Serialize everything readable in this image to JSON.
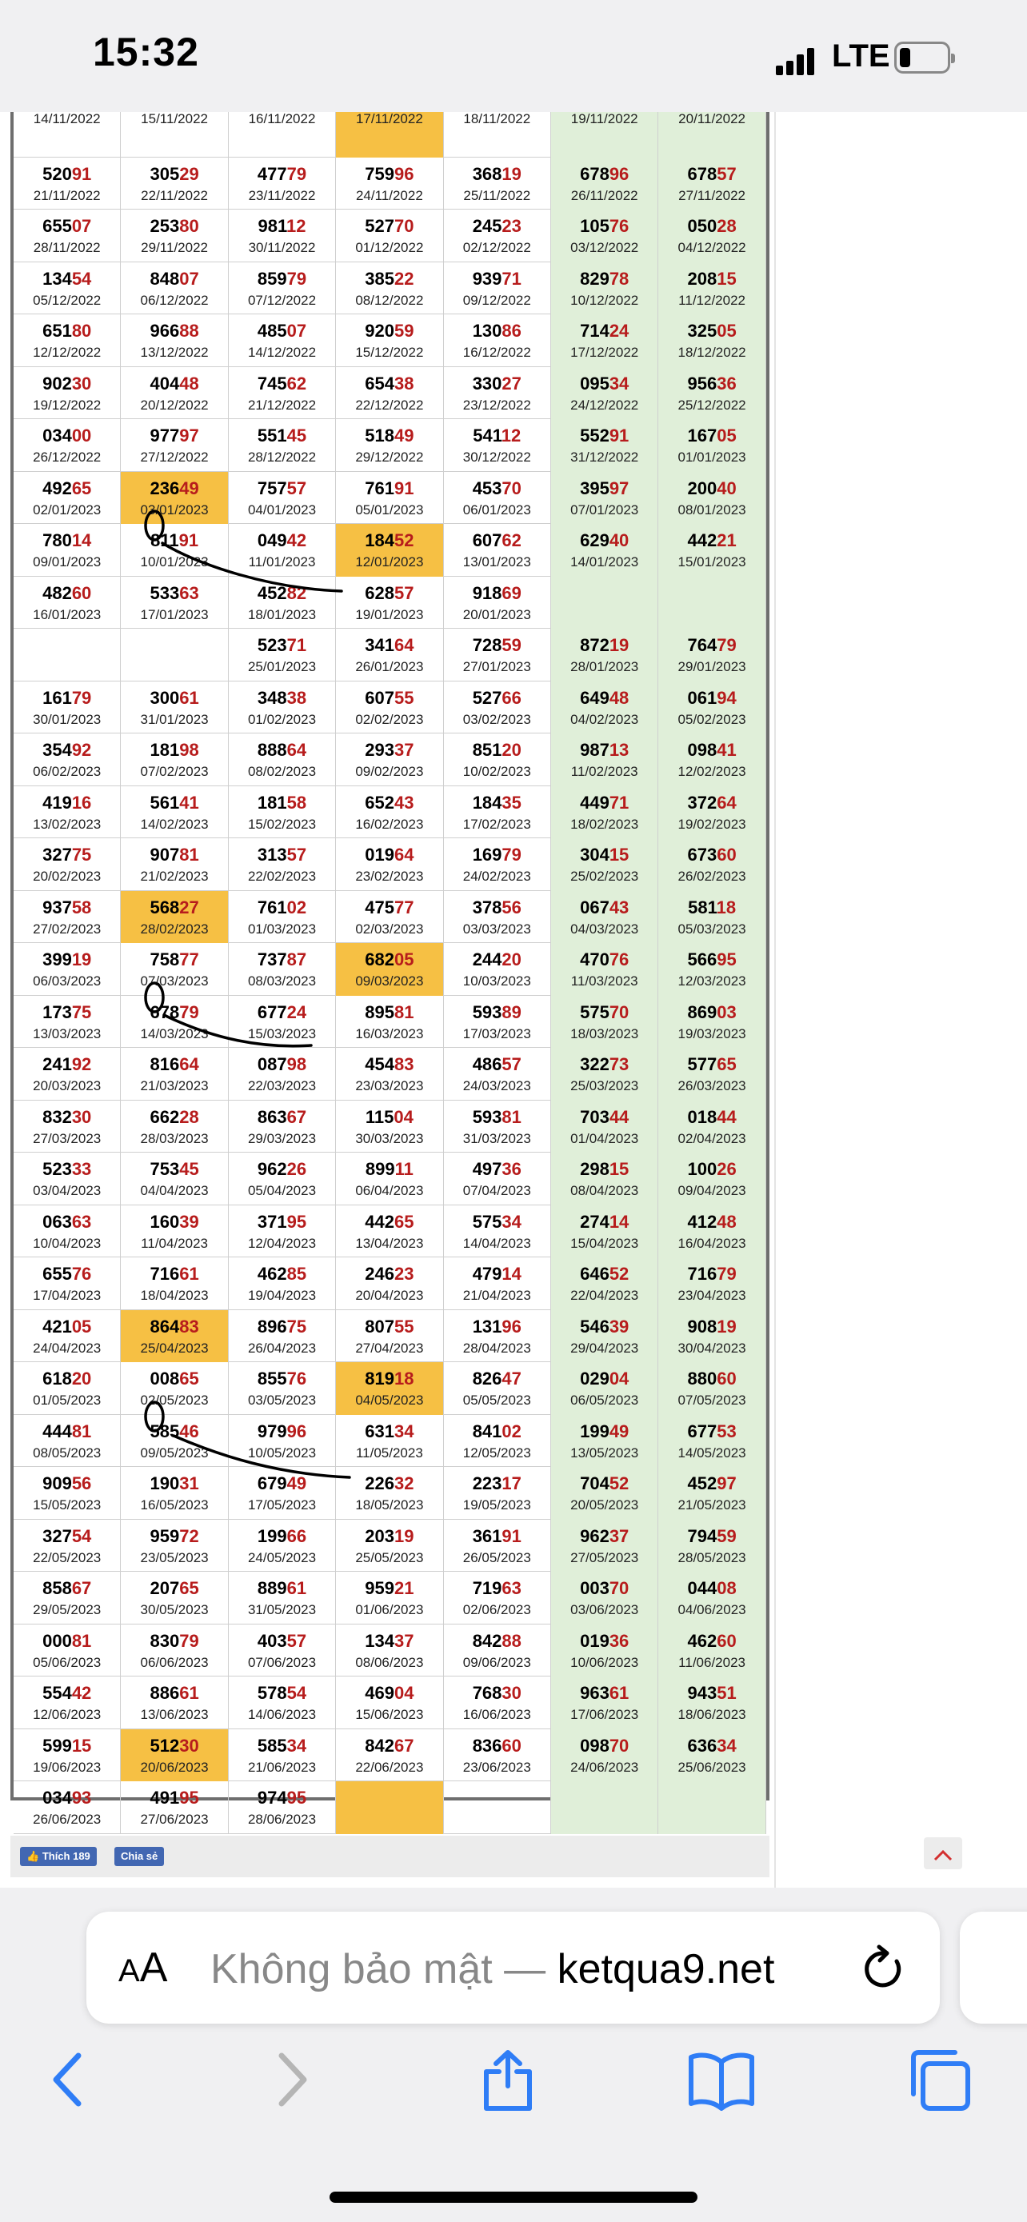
{
  "status_bar": {
    "time": "15:32",
    "network": "LTE"
  },
  "table": {
    "rows": [
      [
        [
          "",
          "14/11/2022"
        ],
        [
          "",
          "15/11/2022"
        ],
        [
          "",
          "16/11/2022"
        ],
        [
          "",
          "17/11/2022",
          "hl"
        ],
        [
          "",
          "18/11/2022"
        ],
        [
          "",
          "19/11/2022"
        ],
        [
          "",
          "20/11/2022"
        ]
      ],
      [
        [
          "52091",
          "21/11/2022"
        ],
        [
          "30529",
          "22/11/2022"
        ],
        [
          "47779",
          "23/11/2022"
        ],
        [
          "75996",
          "24/11/2022"
        ],
        [
          "36819",
          "25/11/2022"
        ],
        [
          "67896",
          "26/11/2022"
        ],
        [
          "67857",
          "27/11/2022"
        ]
      ],
      [
        [
          "65507",
          "28/11/2022"
        ],
        [
          "25380",
          "29/11/2022"
        ],
        [
          "98112",
          "30/11/2022"
        ],
        [
          "52770",
          "01/12/2022"
        ],
        [
          "24523",
          "02/12/2022"
        ],
        [
          "10576",
          "03/12/2022"
        ],
        [
          "05028",
          "04/12/2022"
        ]
      ],
      [
        [
          "13454",
          "05/12/2022"
        ],
        [
          "84807",
          "06/12/2022"
        ],
        [
          "85979",
          "07/12/2022"
        ],
        [
          "38522",
          "08/12/2022"
        ],
        [
          "93971",
          "09/12/2022"
        ],
        [
          "82978",
          "10/12/2022"
        ],
        [
          "20815",
          "11/12/2022"
        ]
      ],
      [
        [
          "65180",
          "12/12/2022"
        ],
        [
          "96688",
          "13/12/2022"
        ],
        [
          "48507",
          "14/12/2022"
        ],
        [
          "92059",
          "15/12/2022"
        ],
        [
          "13086",
          "16/12/2022"
        ],
        [
          "71424",
          "17/12/2022"
        ],
        [
          "32505",
          "18/12/2022"
        ]
      ],
      [
        [
          "90230",
          "19/12/2022"
        ],
        [
          "40448",
          "20/12/2022"
        ],
        [
          "74562",
          "21/12/2022"
        ],
        [
          "65438",
          "22/12/2022"
        ],
        [
          "33027",
          "23/12/2022"
        ],
        [
          "09534",
          "24/12/2022"
        ],
        [
          "95636",
          "25/12/2022"
        ]
      ],
      [
        [
          "03400",
          "26/12/2022"
        ],
        [
          "97797",
          "27/12/2022"
        ],
        [
          "55145",
          "28/12/2022"
        ],
        [
          "51849",
          "29/12/2022"
        ],
        [
          "54112",
          "30/12/2022"
        ],
        [
          "55291",
          "31/12/2022"
        ],
        [
          "16705",
          "01/01/2023"
        ]
      ],
      [
        [
          "49265",
          "02/01/2023"
        ],
        [
          "23649",
          "03/01/2023",
          "hl"
        ],
        [
          "75757",
          "04/01/2023"
        ],
        [
          "76191",
          "05/01/2023"
        ],
        [
          "45370",
          "06/01/2023"
        ],
        [
          "39597",
          "07/01/2023"
        ],
        [
          "20040",
          "08/01/2023"
        ]
      ],
      [
        [
          "78014",
          "09/01/2023"
        ],
        [
          "81191",
          "10/01/2023"
        ],
        [
          "04942",
          "11/01/2023"
        ],
        [
          "18452",
          "12/01/2023",
          "hl"
        ],
        [
          "60762",
          "13/01/2023"
        ],
        [
          "62940",
          "14/01/2023"
        ],
        [
          "44221",
          "15/01/2023"
        ]
      ],
      [
        [
          "48260",
          "16/01/2023"
        ],
        [
          "53363",
          "17/01/2023"
        ],
        [
          "45282",
          "18/01/2023"
        ],
        [
          "62857",
          "19/01/2023"
        ],
        [
          "91869",
          "20/01/2023"
        ],
        [
          "",
          ""
        ],
        [
          "",
          ""
        ]
      ],
      [
        [
          "",
          ""
        ],
        [
          "",
          ""
        ],
        [
          "52371",
          "25/01/2023"
        ],
        [
          "34164",
          "26/01/2023"
        ],
        [
          "72859",
          "27/01/2023"
        ],
        [
          "87219",
          "28/01/2023"
        ],
        [
          "76479",
          "29/01/2023"
        ]
      ],
      [
        [
          "16179",
          "30/01/2023"
        ],
        [
          "30061",
          "31/01/2023"
        ],
        [
          "34838",
          "01/02/2023"
        ],
        [
          "60755",
          "02/02/2023"
        ],
        [
          "52766",
          "03/02/2023"
        ],
        [
          "64948",
          "04/02/2023"
        ],
        [
          "06194",
          "05/02/2023"
        ]
      ],
      [
        [
          "35492",
          "06/02/2023"
        ],
        [
          "18198",
          "07/02/2023"
        ],
        [
          "88864",
          "08/02/2023"
        ],
        [
          "29337",
          "09/02/2023"
        ],
        [
          "85120",
          "10/02/2023"
        ],
        [
          "98713",
          "11/02/2023"
        ],
        [
          "09841",
          "12/02/2023"
        ]
      ],
      [
        [
          "41916",
          "13/02/2023"
        ],
        [
          "56141",
          "14/02/2023"
        ],
        [
          "18158",
          "15/02/2023"
        ],
        [
          "65243",
          "16/02/2023"
        ],
        [
          "18435",
          "17/02/2023"
        ],
        [
          "44971",
          "18/02/2023"
        ],
        [
          "37264",
          "19/02/2023"
        ]
      ],
      [
        [
          "32775",
          "20/02/2023"
        ],
        [
          "90781",
          "21/02/2023"
        ],
        [
          "31357",
          "22/02/2023"
        ],
        [
          "01964",
          "23/02/2023"
        ],
        [
          "16979",
          "24/02/2023"
        ],
        [
          "30415",
          "25/02/2023"
        ],
        [
          "67360",
          "26/02/2023"
        ]
      ],
      [
        [
          "93758",
          "27/02/2023"
        ],
        [
          "56827",
          "28/02/2023",
          "hl"
        ],
        [
          "76102",
          "01/03/2023"
        ],
        [
          "47577",
          "02/03/2023"
        ],
        [
          "37856",
          "03/03/2023"
        ],
        [
          "06743",
          "04/03/2023"
        ],
        [
          "58118",
          "05/03/2023"
        ]
      ],
      [
        [
          "39919",
          "06/03/2023"
        ],
        [
          "75877",
          "07/03/2023"
        ],
        [
          "73787",
          "08/03/2023"
        ],
        [
          "68205",
          "09/03/2023",
          "hl"
        ],
        [
          "24420",
          "10/03/2023"
        ],
        [
          "47076",
          "11/03/2023"
        ],
        [
          "56695",
          "12/03/2023"
        ]
      ],
      [
        [
          "17375",
          "13/03/2023"
        ],
        [
          "67879",
          "14/03/2023"
        ],
        [
          "67724",
          "15/03/2023"
        ],
        [
          "89581",
          "16/03/2023"
        ],
        [
          "59389",
          "17/03/2023"
        ],
        [
          "57570",
          "18/03/2023"
        ],
        [
          "86903",
          "19/03/2023"
        ]
      ],
      [
        [
          "24192",
          "20/03/2023"
        ],
        [
          "81664",
          "21/03/2023"
        ],
        [
          "08798",
          "22/03/2023"
        ],
        [
          "45483",
          "23/03/2023"
        ],
        [
          "48657",
          "24/03/2023"
        ],
        [
          "32273",
          "25/03/2023"
        ],
        [
          "57765",
          "26/03/2023"
        ]
      ],
      [
        [
          "83230",
          "27/03/2023"
        ],
        [
          "66228",
          "28/03/2023"
        ],
        [
          "86367",
          "29/03/2023"
        ],
        [
          "11504",
          "30/03/2023"
        ],
        [
          "59381",
          "31/03/2023"
        ],
        [
          "70344",
          "01/04/2023"
        ],
        [
          "01844",
          "02/04/2023"
        ]
      ],
      [
        [
          "52333",
          "03/04/2023"
        ],
        [
          "75345",
          "04/04/2023"
        ],
        [
          "96226",
          "05/04/2023"
        ],
        [
          "89911",
          "06/04/2023"
        ],
        [
          "49736",
          "07/04/2023"
        ],
        [
          "29815",
          "08/04/2023"
        ],
        [
          "10026",
          "09/04/2023"
        ]
      ],
      [
        [
          "06363",
          "10/04/2023"
        ],
        [
          "16039",
          "11/04/2023"
        ],
        [
          "37195",
          "12/04/2023"
        ],
        [
          "44265",
          "13/04/2023"
        ],
        [
          "57534",
          "14/04/2023"
        ],
        [
          "27414",
          "15/04/2023"
        ],
        [
          "41248",
          "16/04/2023"
        ]
      ],
      [
        [
          "65576",
          "17/04/2023"
        ],
        [
          "71661",
          "18/04/2023"
        ],
        [
          "46285",
          "19/04/2023"
        ],
        [
          "24623",
          "20/04/2023"
        ],
        [
          "47914",
          "21/04/2023"
        ],
        [
          "64652",
          "22/04/2023"
        ],
        [
          "71679",
          "23/04/2023"
        ]
      ],
      [
        [
          "42105",
          "24/04/2023"
        ],
        [
          "86483",
          "25/04/2023",
          "hl"
        ],
        [
          "89675",
          "26/04/2023"
        ],
        [
          "80755",
          "27/04/2023"
        ],
        [
          "13196",
          "28/04/2023"
        ],
        [
          "54639",
          "29/04/2023"
        ],
        [
          "90819",
          "30/04/2023"
        ]
      ],
      [
        [
          "61820",
          "01/05/2023"
        ],
        [
          "00865",
          "02/05/2023"
        ],
        [
          "85576",
          "03/05/2023"
        ],
        [
          "81918",
          "04/05/2023",
          "hl"
        ],
        [
          "82647",
          "05/05/2023"
        ],
        [
          "02904",
          "06/05/2023"
        ],
        [
          "88060",
          "07/05/2023"
        ]
      ],
      [
        [
          "44481",
          "08/05/2023"
        ],
        [
          "58546",
          "09/05/2023"
        ],
        [
          "97996",
          "10/05/2023"
        ],
        [
          "63134",
          "11/05/2023"
        ],
        [
          "84102",
          "12/05/2023"
        ],
        [
          "19949",
          "13/05/2023"
        ],
        [
          "67753",
          "14/05/2023"
        ]
      ],
      [
        [
          "90956",
          "15/05/2023"
        ],
        [
          "19031",
          "16/05/2023"
        ],
        [
          "67949",
          "17/05/2023"
        ],
        [
          "22632",
          "18/05/2023"
        ],
        [
          "22317",
          "19/05/2023"
        ],
        [
          "70452",
          "20/05/2023"
        ],
        [
          "45297",
          "21/05/2023"
        ]
      ],
      [
        [
          "32754",
          "22/05/2023"
        ],
        [
          "95972",
          "23/05/2023"
        ],
        [
          "19966",
          "24/05/2023"
        ],
        [
          "20319",
          "25/05/2023"
        ],
        [
          "36191",
          "26/05/2023"
        ],
        [
          "96237",
          "27/05/2023"
        ],
        [
          "79459",
          "28/05/2023"
        ]
      ],
      [
        [
          "85867",
          "29/05/2023"
        ],
        [
          "20765",
          "30/05/2023"
        ],
        [
          "88961",
          "31/05/2023"
        ],
        [
          "95921",
          "01/06/2023"
        ],
        [
          "71963",
          "02/06/2023"
        ],
        [
          "00370",
          "03/06/2023"
        ],
        [
          "04408",
          "04/06/2023"
        ]
      ],
      [
        [
          "00081",
          "05/06/2023"
        ],
        [
          "83079",
          "06/06/2023"
        ],
        [
          "40357",
          "07/06/2023"
        ],
        [
          "13437",
          "08/06/2023"
        ],
        [
          "84288",
          "09/06/2023"
        ],
        [
          "01936",
          "10/06/2023"
        ],
        [
          "46260",
          "11/06/2023"
        ]
      ],
      [
        [
          "55442",
          "12/06/2023"
        ],
        [
          "88661",
          "13/06/2023"
        ],
        [
          "57854",
          "14/06/2023"
        ],
        [
          "46904",
          "15/06/2023"
        ],
        [
          "76830",
          "16/06/2023"
        ],
        [
          "96361",
          "17/06/2023"
        ],
        [
          "94351",
          "18/06/2023"
        ]
      ],
      [
        [
          "59915",
          "19/06/2023"
        ],
        [
          "51230",
          "20/06/2023",
          "hl"
        ],
        [
          "58534",
          "21/06/2023"
        ],
        [
          "84267",
          "22/06/2023"
        ],
        [
          "83660",
          "23/06/2023"
        ],
        [
          "09870",
          "24/06/2023"
        ],
        [
          "63634",
          "25/06/2023"
        ]
      ],
      [
        [
          "03493",
          "26/06/2023"
        ],
        [
          "49195",
          "27/06/2023"
        ],
        [
          "97495",
          "28/06/2023"
        ],
        [
          "",
          "",
          "hl"
        ],
        [
          "",
          ""
        ],
        [
          "",
          ""
        ],
        [
          "",
          ""
        ]
      ]
    ]
  },
  "social": {
    "like_label": "Thích 189",
    "share_label": "Chia sẻ"
  },
  "browser": {
    "text_size_label_small": "A",
    "text_size_label_large": "A",
    "url_prefix": "Không bảo mật — ",
    "url_domain": "ketqua9.net"
  },
  "colors": {
    "highlight": "#f6c044",
    "weekend": "#e0efd9",
    "tail_digits": "#b71c1c",
    "annotation_ink": "#000000"
  }
}
